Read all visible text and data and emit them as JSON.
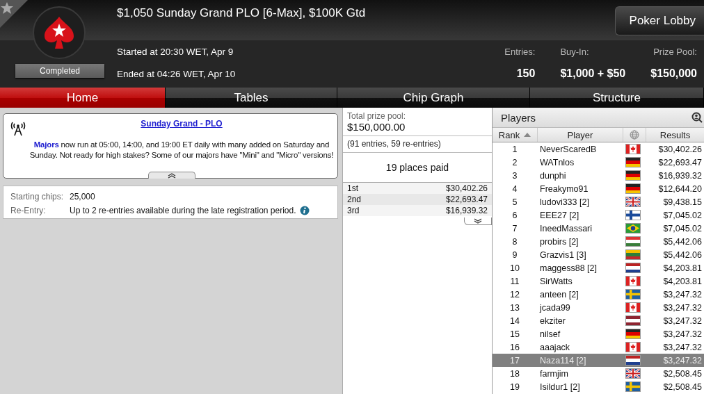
{
  "header": {
    "title": "$1,050 Sunday Grand PLO [6-Max], $100K Gtd",
    "status": "Completed",
    "started": "Started at 20:30 WET, Apr 9",
    "ended": "Ended at 04:26 WET, Apr 10",
    "lobby_button": "Poker Lobby",
    "stats": [
      {
        "label": "Entries:",
        "value": "150"
      },
      {
        "label": "Buy-In:",
        "value": "$1,000 + $50"
      },
      {
        "label": "Prize Pool:",
        "value": "$150,000"
      }
    ]
  },
  "tabs": [
    {
      "label": "Home",
      "selected": true
    },
    {
      "label": "Tables",
      "selected": false
    },
    {
      "label": "Chip Graph",
      "selected": false
    },
    {
      "label": "Structure",
      "selected": false
    }
  ],
  "news": {
    "title": "Sunday Grand - PLO",
    "body": "**Majors** now run at 05:00, 14:00, and 19:00 ET daily with many added on Saturday and Sunday. Not ready for high stakes? Some of our majors have \"Mini\" and \"Micro\" versions!"
  },
  "details": [
    {
      "label": "Starting chips:",
      "value": "25,000"
    },
    {
      "label": "Re-Entry:",
      "value": "Up to 2 re-entries available during the late registration period."
    }
  ],
  "prizes": {
    "label": "Total prize pool:",
    "total": "$150,000.00",
    "entries": "(91 entries, 59 re-entries)",
    "places": "19 places paid",
    "rows": [
      {
        "place": "1st",
        "amount": "$30,402.26"
      },
      {
        "place": "2nd",
        "amount": "$22,693.47"
      },
      {
        "place": "3rd",
        "amount": "$16,939.32"
      }
    ]
  },
  "players": {
    "title": "Players",
    "columns": [
      "Rank",
      "Player",
      "Results"
    ],
    "rows": [
      {
        "rank": "1",
        "name": "NeverScaredB",
        "kind": "ca",
        "result": "$30,402.26",
        "selected": false
      },
      {
        "rank": "2",
        "name": "WATnlos",
        "kind": "de",
        "result": "$22,693.47",
        "selected": false
      },
      {
        "rank": "3",
        "name": "dunphi",
        "kind": "de",
        "result": "$16,939.32",
        "selected": false
      },
      {
        "rank": "4",
        "name": "Freakymo91",
        "kind": "de",
        "result": "$12,644.20",
        "selected": false
      },
      {
        "rank": "5",
        "name": "ludovi333 [2]",
        "kind": "gb",
        "result": "$9,438.15",
        "selected": false
      },
      {
        "rank": "6",
        "name": "EEE27 [2]",
        "kind": "fi",
        "result": "$7,045.02",
        "selected": false
      },
      {
        "rank": "7",
        "name": "IneedMassari",
        "kind": "br",
        "result": "$7,045.02",
        "selected": false
      },
      {
        "rank": "8",
        "name": "probirs [2]",
        "kind": "hu",
        "result": "$5,442.06",
        "selected": false
      },
      {
        "rank": "9",
        "name": "Grazvis1 [3]",
        "kind": "lt",
        "result": "$5,442.06",
        "selected": false
      },
      {
        "rank": "10",
        "name": "maggess88 [2]",
        "kind": "nl",
        "result": "$4,203.81",
        "selected": false
      },
      {
        "rank": "11",
        "name": "SirWatts",
        "kind": "ca",
        "result": "$4,203.81",
        "selected": false
      },
      {
        "rank": "12",
        "name": "anteen [2]",
        "kind": "se",
        "result": "$3,247.32",
        "selected": false
      },
      {
        "rank": "13",
        "name": "jcada99",
        "kind": "ca",
        "result": "$3,247.32",
        "selected": false
      },
      {
        "rank": "14",
        "name": "ekziter",
        "kind": "lv",
        "result": "$3,247.32",
        "selected": false
      },
      {
        "rank": "15",
        "name": "nilsef",
        "kind": "de",
        "result": "$3,247.32",
        "selected": false
      },
      {
        "rank": "16",
        "name": "aaajack",
        "kind": "ca",
        "result": "$3,247.32",
        "selected": false
      },
      {
        "rank": "17",
        "name": "Naza114 [2]",
        "kind": "nl",
        "result": "$3,247.32",
        "selected": true
      },
      {
        "rank": "18",
        "name": "farmjim",
        "kind": "gb",
        "result": "$2,508.45",
        "selected": false
      },
      {
        "rank": "19",
        "name": "Isildur1 [2]",
        "kind": "se",
        "result": "$2,508.45",
        "selected": false
      }
    ]
  }
}
